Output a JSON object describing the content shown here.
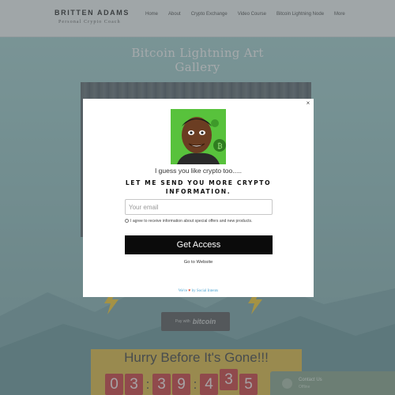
{
  "site": {
    "brand_name": "BRITTEN ADAMS",
    "brand_subtitle": "Personal Crypto Coach",
    "nav": [
      "Home",
      "About",
      "Crypto Exchange",
      "Video Course",
      "Bitcoin Lightning Node",
      "More"
    ],
    "page_title_line1": "Bitcoin Lightning Art",
    "page_title_line2": "Gallery",
    "pay_with_label": "Pay with",
    "pay_coin_label": "bitcoin",
    "hurry_text": "Hurry Before It's Gone!!!",
    "countdown": [
      "0",
      "3",
      ":",
      "3",
      "9",
      ":",
      "4",
      "3",
      "5"
    ],
    "contact_name": "Contact Us",
    "contact_status": "Offline"
  },
  "popup": {
    "close_glyph": "×",
    "greeting": "I guess you like crypto too.....",
    "headline": "LET ME SEND YOU MORE CRYPTO INFORMATION.",
    "email_placeholder": "Your email",
    "agree_text": "I agree to receive information about special offers and new products.",
    "cta_label": "Get Access",
    "goto_label": "Go to Website",
    "powered_prefix": "We're",
    "powered_heart": "♥",
    "powered_suffix": "by Social Intents"
  },
  "colors": {
    "overlay": "#46505573",
    "cta": "#0b0b0b",
    "hurry_bg": "#ddbb4b",
    "digit_bg": "#cc4646",
    "avatar_bg": "#58c23c"
  }
}
